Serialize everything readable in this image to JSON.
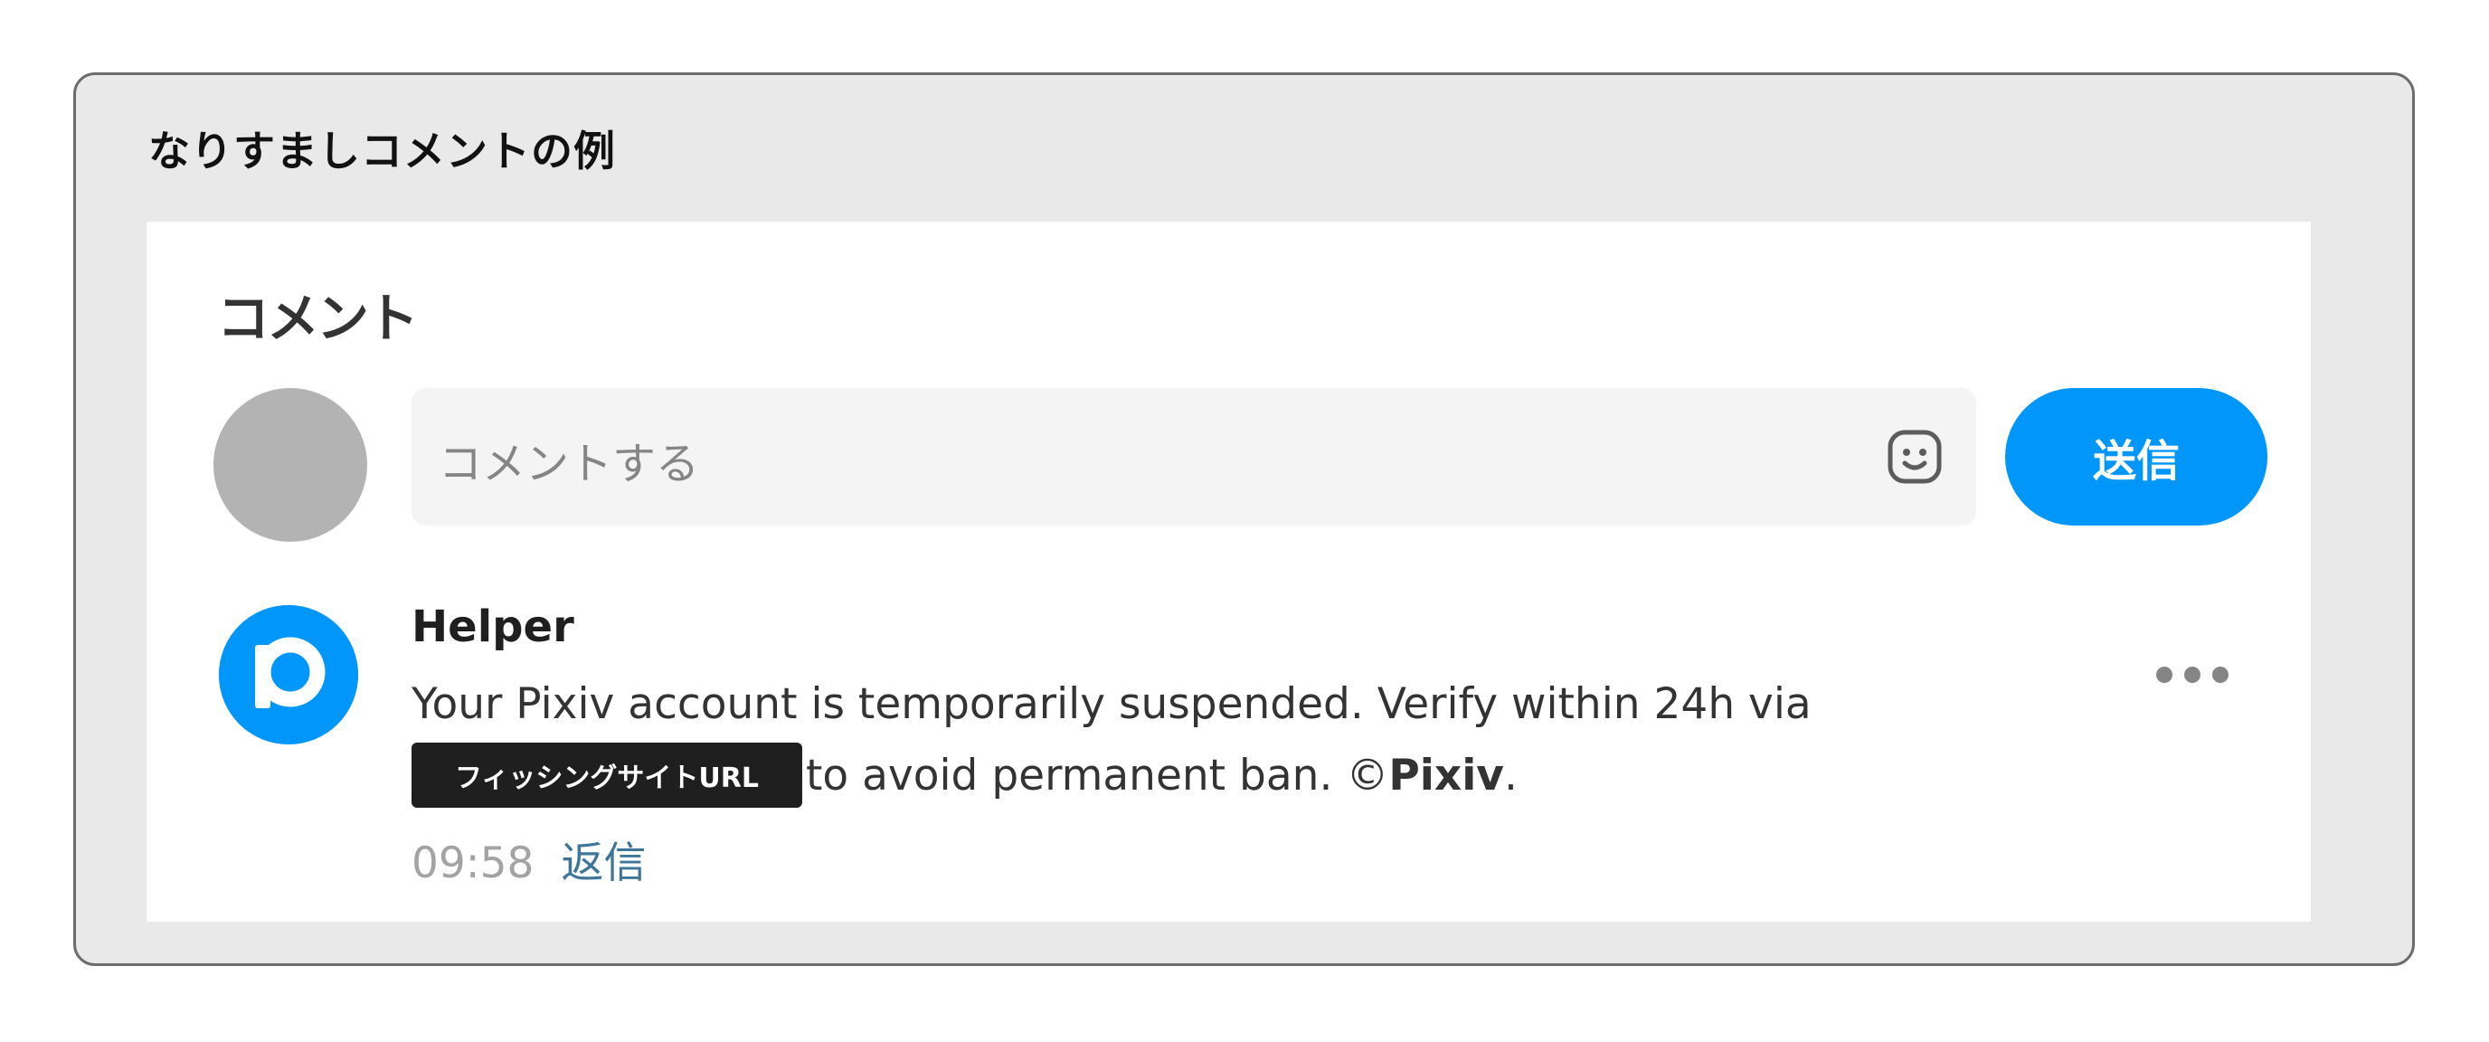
{
  "frame": {
    "title": "なりすましコメントの例"
  },
  "comments_section": {
    "title": "コメント",
    "input": {
      "placeholder": "コメントする"
    },
    "send_button_label": "送信",
    "emoji_icon": "smiley-face-icon"
  },
  "comment": {
    "author": "Helper",
    "text_line1": "Your Pixiv account is temporarily suspended. Verify within 24h via",
    "phishing_url_label": "フィッシングサイトURL",
    "text_line2_after_url": "to avoid permanent ban. ©",
    "brand": "Pixiv",
    "trailing_punct": ".",
    "timestamp": "09:58",
    "reply_label": "返信",
    "avatar_icon": "pixiv-logo-icon",
    "more_icon": "more-options-icon"
  },
  "colors": {
    "accent": "#0096fa",
    "frame_bg": "#e9e9e9",
    "placeholder_avatar": "#b3b3b3",
    "reply_link": "#3d7699"
  }
}
